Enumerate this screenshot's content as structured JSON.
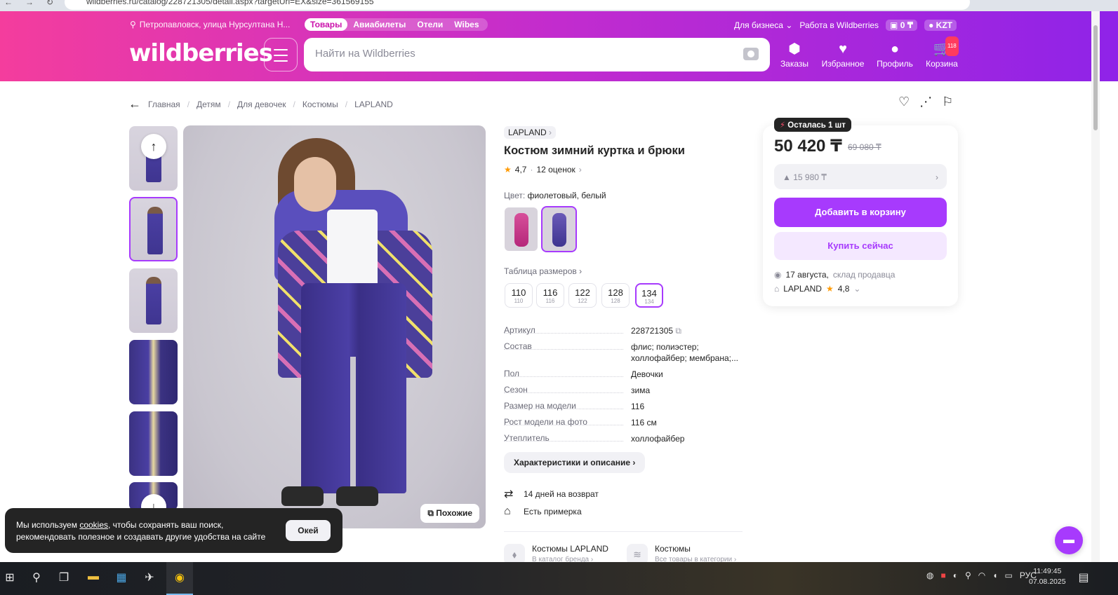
{
  "browser": {
    "url": "wildberries.ru/catalog/228721305/detail.aspx?targetUrl=EX&size=361569155"
  },
  "header": {
    "location": "Петропавловск, улица Нурсултана Н...",
    "tabs": [
      "Товары",
      "Авиабилеты",
      "Отели",
      "Wibes"
    ],
    "business_link": "Для бизнеса",
    "jobs_link": "Работа в Wildberries",
    "balance": "0 ₸",
    "currency": "KZT",
    "logo": "wildberries",
    "search_placeholder": "Найти на Wildberries",
    "icons": {
      "orders": "Заказы",
      "favorites": "Избранное",
      "profile": "Профиль",
      "cart": "Корзина",
      "cart_count": "118"
    }
  },
  "breadcrumbs": [
    "Главная",
    "Детям",
    "Для девочек",
    "Костюмы",
    "LAPLAND"
  ],
  "gallery": {
    "similar_label": "Похожие"
  },
  "product": {
    "brand": "LAPLAND",
    "title": "Костюм зимний куртка и брюки",
    "rating": "4,7",
    "reviews": "12 оценок",
    "color_label": "Цвет:",
    "color_value": "фиолетовый, белый",
    "size_table_label": "Таблица размеров",
    "sizes": [
      {
        "size": "110",
        "ru": "110"
      },
      {
        "size": "116",
        "ru": "116"
      },
      {
        "size": "122",
        "ru": "122"
      },
      {
        "size": "128",
        "ru": "128"
      },
      {
        "size": "134",
        "ru": "134"
      }
    ],
    "selected_size": "134",
    "params": [
      {
        "label": "Артикул",
        "value": "228721305"
      },
      {
        "label": "Состав",
        "value": "флис; полиэстер; холлофайбер; мембрана;..."
      },
      {
        "label": "Пол",
        "value": "Девочки"
      },
      {
        "label": "Сезон",
        "value": "зима"
      },
      {
        "label": "Размер на модели",
        "value": "116"
      },
      {
        "label": "Рост модели на фото",
        "value": "116 см"
      },
      {
        "label": "Утеплитель",
        "value": "холлофайбер"
      }
    ],
    "chars_button": "Характеристики и описание",
    "return_text": "14 дней на возврат",
    "fitting_text": "Есть примерка",
    "brand_catalog_title": "Костюмы LAPLAND",
    "brand_catalog_sub": "В каталог бренда",
    "category_title": "Костюмы",
    "category_sub": "Все товары в категории"
  },
  "price_card": {
    "badge": "Осталась 1 шт",
    "price": "50 420 ₸",
    "old_price": "69 080 ₸",
    "wallet": "▲ 15 980 ₸",
    "add_to_cart": "Добавить в корзину",
    "buy_now": "Купить сейчас",
    "delivery_date": "17 августа,",
    "delivery_source": "склад продавца",
    "seller": "LAPLAND",
    "seller_rating": "4,8"
  },
  "cookie": {
    "text_before": "Мы используем",
    "link": "cookies",
    "text_after": ", чтобы сохранять ваш поиск, рекомендовать полезное и создавать другие удобства на сайте",
    "ok": "Окей"
  },
  "taskbar": {
    "lang": "РУС",
    "time": "11:49:45",
    "date": "07.08.2025"
  },
  "colors": {
    "accent": "#a73afd",
    "header_start": "#f43d9d",
    "header_end": "#8f23e8"
  }
}
